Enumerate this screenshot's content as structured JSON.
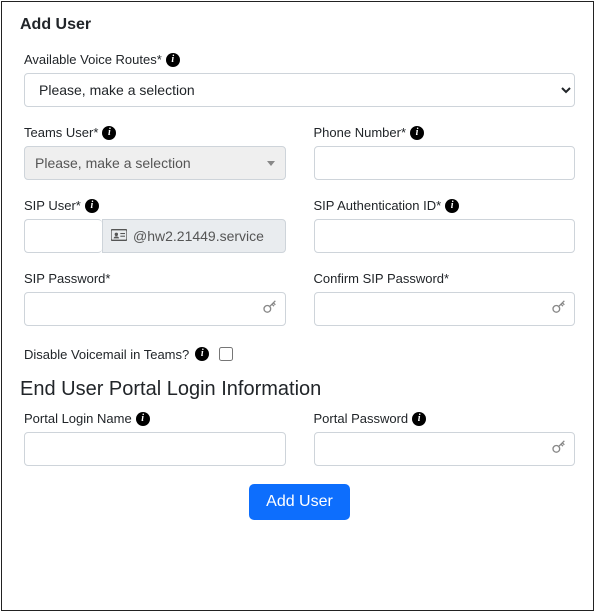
{
  "title": "Add User",
  "fields": {
    "voiceRoutes": {
      "label": "Available Voice Routes*",
      "placeholder": "Please, make a selection"
    },
    "teamsUser": {
      "label": "Teams User*",
      "placeholder": "Please, make a selection"
    },
    "phoneNumber": {
      "label": "Phone Number*"
    },
    "sipUser": {
      "label": "SIP User*",
      "domain": "@hw2.21449.service",
      "value": ""
    },
    "sipAuthId": {
      "label": "SIP Authentication ID*"
    },
    "sipPassword": {
      "label": "SIP Password*"
    },
    "confirmSipPassword": {
      "label": "Confirm SIP Password*"
    },
    "disableVoicemail": {
      "label": "Disable Voicemail in Teams?",
      "checked": false
    }
  },
  "section2": {
    "heading": "End User Portal Login Information",
    "portalLogin": {
      "label": "Portal Login Name"
    },
    "portalPassword": {
      "label": "Portal Password"
    }
  },
  "submitLabel": "Add User"
}
